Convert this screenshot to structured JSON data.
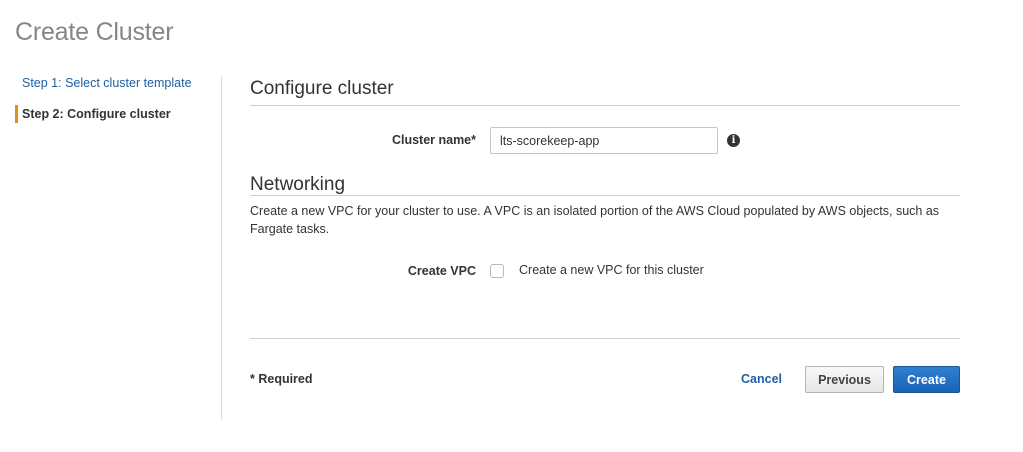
{
  "page": {
    "title": "Create Cluster"
  },
  "sidebar": {
    "steps": [
      {
        "label": "Step 1: Select cluster template",
        "active": false
      },
      {
        "label": "Step 2: Configure cluster",
        "active": true
      }
    ]
  },
  "configure": {
    "title": "Configure cluster",
    "cluster_name_label": "Cluster name*",
    "cluster_name_value": "lts-scorekeep-app",
    "info_icon": "info-circle-icon"
  },
  "networking": {
    "title": "Networking",
    "description": "Create a new VPC for your cluster to use. A VPC is an isolated portion of the AWS Cloud populated by AWS objects, such as Fargate tasks.",
    "create_vpc_label": "Create VPC",
    "create_vpc_checkbox_label": "Create a new VPC for this cluster",
    "create_vpc_checked": false
  },
  "footer": {
    "required_note": "* Required",
    "cancel_label": "Cancel",
    "previous_label": "Previous",
    "create_label": "Create"
  },
  "colors": {
    "link": "#1e5fa6",
    "active_step_marker": "#e38d1a",
    "primary_button": "#1a63b7"
  }
}
